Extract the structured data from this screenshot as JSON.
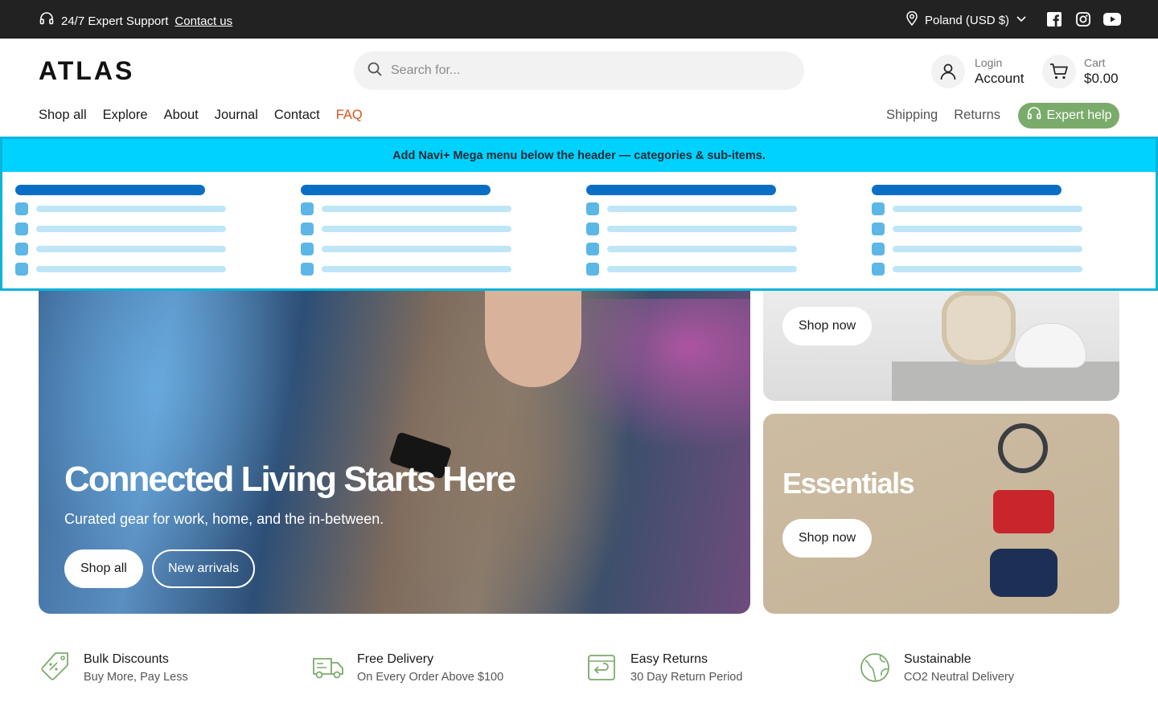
{
  "topbar": {
    "support_text": "24/7 Expert Support",
    "contact_link": "Contact us",
    "region": "Poland (USD $)",
    "socials": [
      "facebook-icon",
      "instagram-icon",
      "youtube-icon"
    ]
  },
  "header": {
    "logo": "ATLAS",
    "search_placeholder": "Search for...",
    "account": {
      "small": "Login",
      "big": "Account"
    },
    "cart": {
      "small": "Cart",
      "big": "$0.00"
    }
  },
  "nav": {
    "items": [
      "Shop all",
      "Explore",
      "About",
      "Journal",
      "Contact",
      "FAQ"
    ],
    "right": [
      "Shipping",
      "Returns"
    ],
    "expert_help": "Expert help"
  },
  "mega_menu": {
    "banner": "Add Navi+ Mega menu below the header — categories & sub-items."
  },
  "hero": {
    "title": "Connected Living Starts Here",
    "subtitle": "Curated gear for work, home, and the in-between.",
    "primary_button": "Shop all",
    "secondary_button": "New arrivals"
  },
  "tiles": [
    {
      "title": "",
      "button": "Shop now"
    },
    {
      "title": "Essentials",
      "button": "Shop now"
    }
  ],
  "features": [
    {
      "icon": "tag-percent-icon",
      "title": "Bulk Discounts",
      "subtitle": "Buy More, Pay Less"
    },
    {
      "icon": "truck-icon",
      "title": "Free Delivery",
      "subtitle": "On Every Order Above $100"
    },
    {
      "icon": "return-box-icon",
      "title": "Easy Returns",
      "subtitle": "30 Day Return Period"
    },
    {
      "icon": "globe-leaf-icon",
      "title": "Sustainable",
      "subtitle": "CO2 Neutral Delivery"
    }
  ],
  "colors": {
    "topbar_bg": "#222222",
    "accent_faq": "#d9531e",
    "expert_green": "#7aab6a",
    "feature_icon_green": "#7aab6a",
    "mega_band": "#00d2ff"
  }
}
